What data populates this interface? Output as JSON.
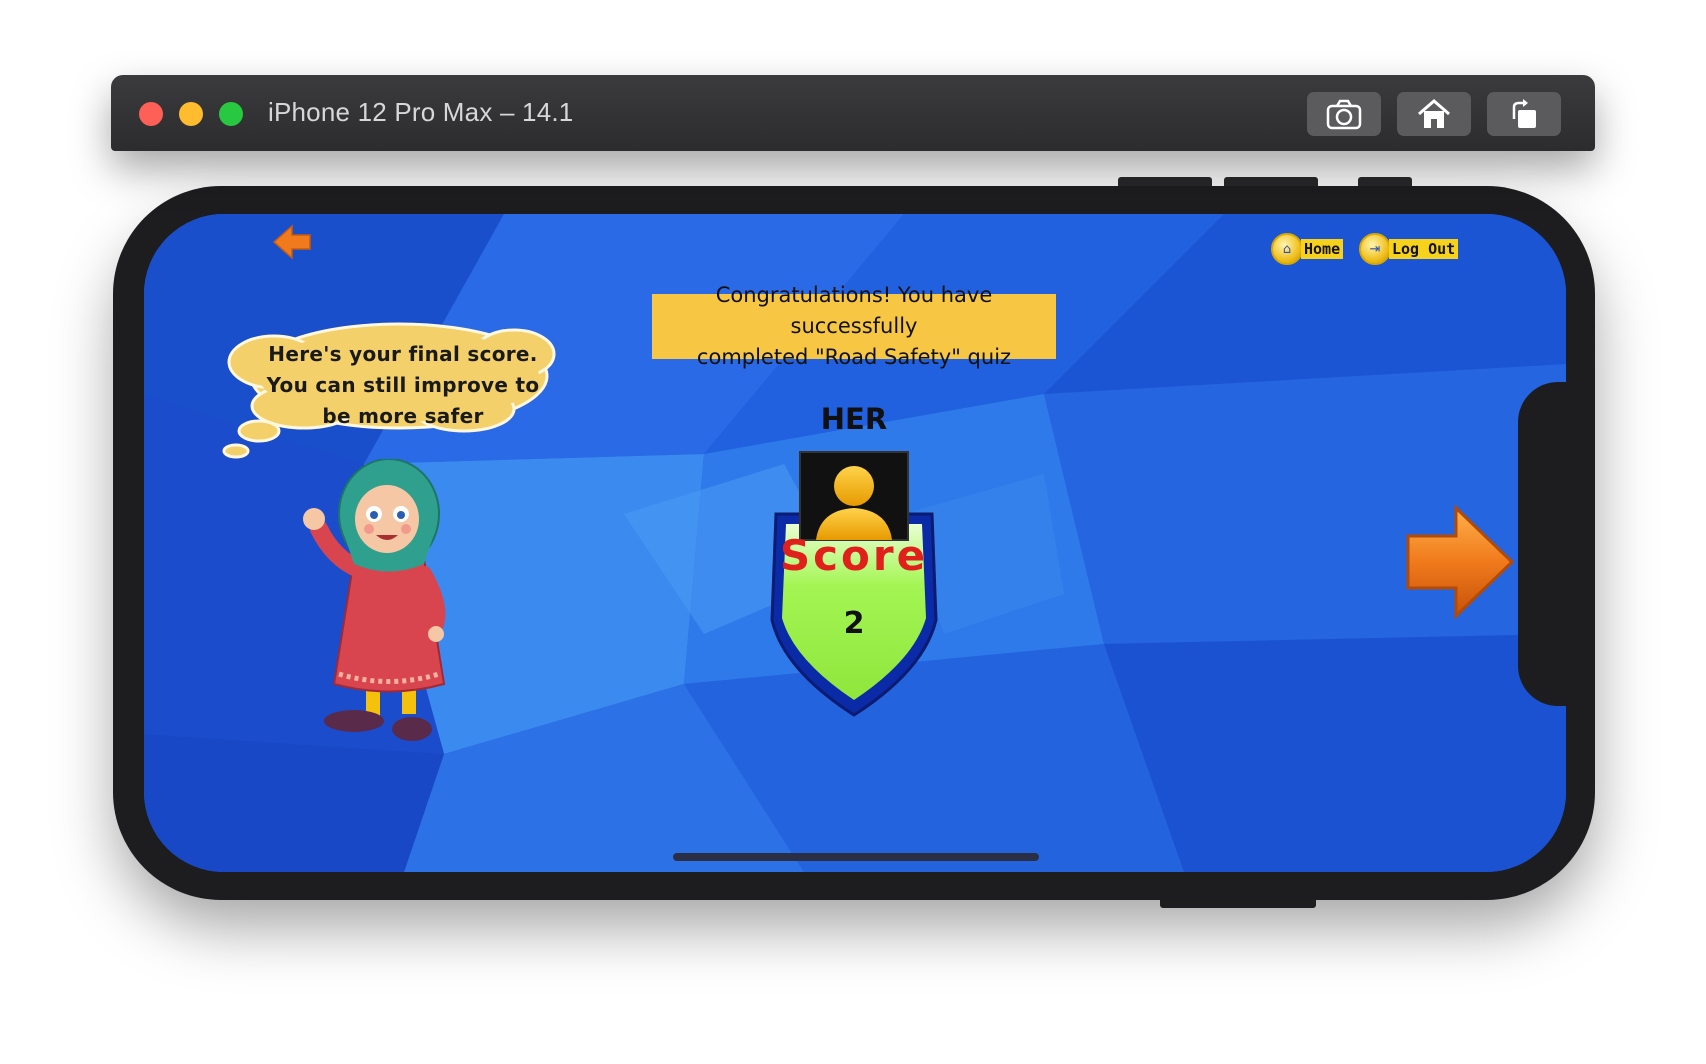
{
  "window": {
    "title": "iPhone 12 Pro Max – 14.1",
    "toolbar_buttons": [
      "camera-icon",
      "home-icon",
      "rotate-icon"
    ]
  },
  "nav": {
    "home_label": "Home",
    "logout_label": "Log Out"
  },
  "banner": {
    "line1": "Congratulations! You have successfully",
    "line2": "completed \"Road Safety\" quiz"
  },
  "speech": {
    "line1": "Here's your final score.",
    "line2": "You can still improve to",
    "line3": "be more safer"
  },
  "player": {
    "name": "HER"
  },
  "score": {
    "label": "Score",
    "value": "2"
  },
  "colors": {
    "background": "#1c57d8",
    "banner": "#f7c743",
    "shield_fill": "#a4f553",
    "score_label": "#e0201a",
    "arrow": "#f07a1c"
  }
}
